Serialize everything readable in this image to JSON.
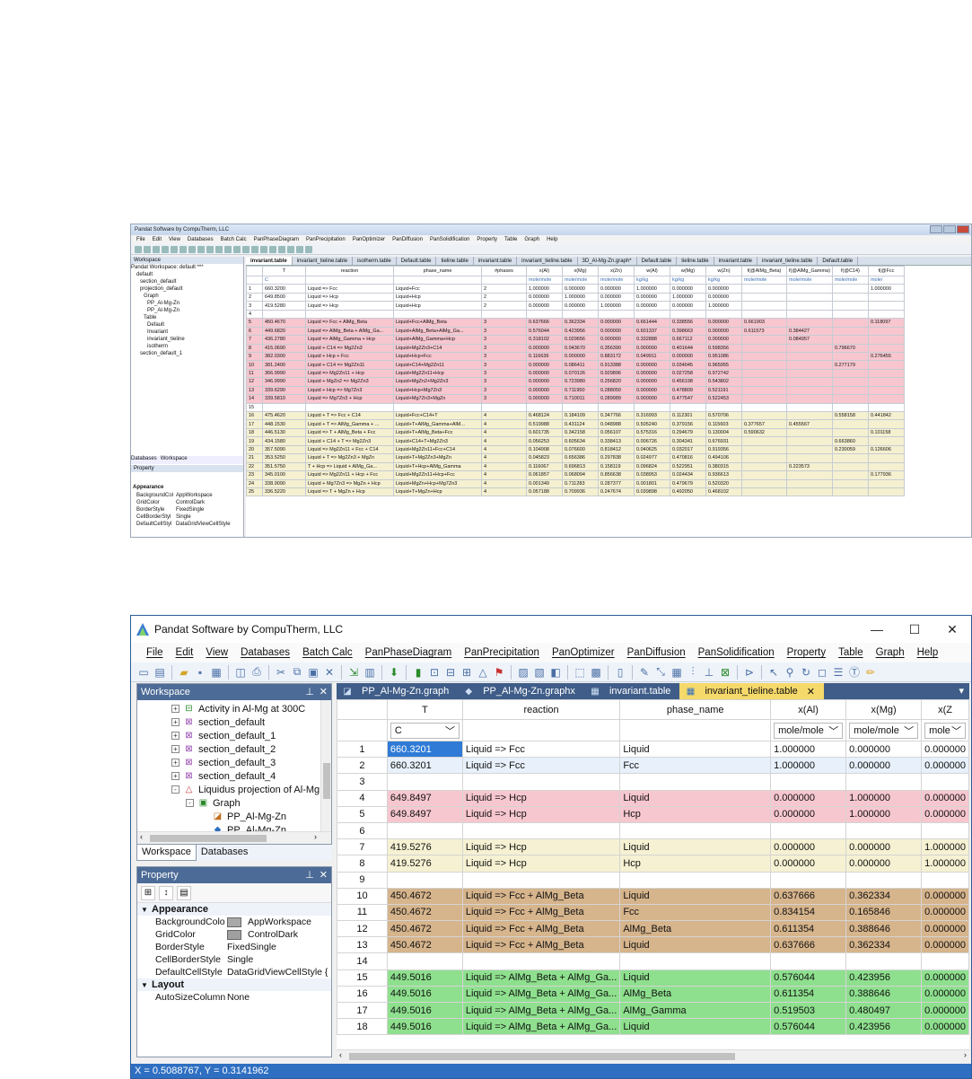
{
  "small_screenshot": {
    "title": "Pandat Software by CompuTherm, LLC",
    "menu": [
      "File",
      "Edit",
      "View",
      "Databases",
      "Batch Calc",
      "PanPhaseDiagram",
      "PanPrecipitation",
      "PanOptimizer",
      "PanDiffusion",
      "PanSolidification",
      "Property",
      "Table",
      "Graph",
      "Help"
    ],
    "workspace_header": "Workspace",
    "tree": [
      "Pandat Workspace: default ***",
      "default",
      "section_default",
      "projection_default",
      "Graph",
      "PP_Al-Mg-Zn",
      "PP_Al-Mg-Zn",
      "Table",
      "Default",
      "Invariant",
      "invariant_tieline",
      "isotherm",
      "section_default_1"
    ],
    "tabs": [
      "invariant.table",
      "invariant_tieline.table",
      "isotherm.table",
      "Default.table",
      "tieline.table",
      "invariant.table",
      "invariant_tieline.table",
      "3D_Al-Mg-Zn.graph*",
      "Default.table",
      "tieline.table",
      "invariant.table",
      "invariant_tieline.table",
      "Default.table"
    ],
    "columns": [
      "",
      "T",
      "reaction",
      "phase_name",
      "#phases",
      "x(Al)",
      "x(Mg)",
      "x(Zn)",
      "w(Al)",
      "w(Mg)",
      "w(Zn)",
      "f(@AlMg_Beta)",
      "f(@AlMg_Gamma)",
      "f(@C14)",
      "f(@Fcc"
    ],
    "units": [
      "",
      "C",
      "",
      "",
      "",
      "mole/mole",
      "mole/mole",
      "mole/mole",
      "kg/kg",
      "kg/kg",
      "kg/kg",
      "mole/mole",
      "mole/mole",
      "mole/mole",
      "mole/"
    ],
    "rows": [
      {
        "c": "wt",
        "v": [
          "1",
          "660.3200",
          "Liquid => Fcc",
          "Liquid+Fcc",
          "2",
          "1.000000",
          "0.000000",
          "0.000000",
          "1.000000",
          "0.000000",
          "0.000000",
          "",
          "",
          "",
          "1.000000"
        ]
      },
      {
        "c": "wt",
        "v": [
          "2",
          "649.8500",
          "Liquid => Hcp",
          "Liquid+Hcp",
          "2",
          "0.000000",
          "1.000000",
          "0.000000",
          "0.000000",
          "1.000000",
          "0.000000",
          "",
          "",
          "",
          ""
        ]
      },
      {
        "c": "wt",
        "v": [
          "3",
          "419.5280",
          "Liquid => Hcp",
          "Liquid+Hcp",
          "2",
          "0.000000",
          "0.000000",
          "1.000000",
          "0.000000",
          "0.000000",
          "1.000000",
          "",
          "",
          "",
          ""
        ]
      },
      {
        "c": "wt",
        "v": [
          "4",
          "",
          "",
          "",
          "",
          "",
          "",
          "",
          "",
          "",
          "",
          "",
          "",
          "",
          ""
        ]
      },
      {
        "c": "pk",
        "v": [
          "5",
          "450.4670",
          "Liquid => Fcc + AlMg_Beta",
          "Liquid+Fcc+AlMg_Beta",
          "3",
          "0.637666",
          "0.362334",
          "0.000000",
          "0.661444",
          "0.338556",
          "0.000000",
          "0.661903",
          "",
          "",
          "0.118097"
        ]
      },
      {
        "c": "pk",
        "v": [
          "6",
          "449.6820",
          "Liquid => AlMg_Beta + AlMg_Ga...",
          "Liquid+AlMg_Beta+AlMg_Ga...",
          "3",
          "0.576044",
          "0.423956",
          "0.000000",
          "0.601337",
          "0.398663",
          "0.000000",
          "0.611573",
          "0.384427",
          "",
          ""
        ]
      },
      {
        "c": "pk",
        "v": [
          "7",
          "436.2780",
          "Liquid => AlMg_Gamma + Hcp",
          "Liquid+AlMg_Gamma+Hcp",
          "3",
          "0.318102",
          "0.029656",
          "0.000000",
          "0.332888",
          "0.667112",
          "0.000000",
          "",
          "0.084957",
          "",
          ""
        ]
      },
      {
        "c": "pk",
        "v": [
          "8",
          "415.0690",
          "Liquid + C14 => Mg2Zn3",
          "Liquid+Mg2Zn3+C14",
          "3",
          "0.000000",
          "0.043670",
          "0.356390",
          "0.000000",
          "0.401644",
          "0.598356",
          "",
          "",
          "0.796670",
          ""
        ]
      },
      {
        "c": "pk",
        "v": [
          "9",
          "382.0300",
          "Liquid + Hcp + Fcc",
          "Liquid+Hcp+Fcc",
          "3",
          "0.116636",
          "0.000000",
          "0.883172",
          "0.049911",
          "0.000000",
          "0.951086",
          "",
          "",
          "",
          "0.276455"
        ]
      },
      {
        "c": "pk",
        "v": [
          "10",
          "381.2400",
          "Liquid + C14 => Mg2Zn11",
          "Liquid+C14+Mg2Zn11",
          "3",
          "0.000000",
          "0.086411",
          "0.913388",
          "0.000000",
          "0.034045",
          "0.965955",
          "",
          "",
          "0.277179",
          ""
        ]
      },
      {
        "c": "pk",
        "v": [
          "11",
          "366.9990",
          "Liquid => Mg2Zn11 + Hcp",
          "Liquid+Mg2Zn11+Hcp",
          "3",
          "0.000000",
          "0.070126",
          "0.929896",
          "0.000000",
          "0.027258",
          "0.972742",
          "",
          "",
          "",
          ""
        ]
      },
      {
        "c": "pk",
        "v": [
          "12",
          "346.9990",
          "Liquid + MgZn2 => Mg2Zn3",
          "Liquid+MgZn2+Mg2Zn3",
          "3",
          "0.000000",
          "0.723980",
          "0.256820",
          "0.000000",
          "0.456198",
          "0.543802",
          "",
          "",
          "",
          ""
        ]
      },
      {
        "c": "pk",
        "v": [
          "13",
          "339.6290",
          "Liquid + Hcp => Mg7Zn3",
          "Liquid+Hcp+Mg7Zn3",
          "3",
          "0.000000",
          "0.711950",
          "0.288050",
          "0.000000",
          "0.478809",
          "0.521191",
          "",
          "",
          "",
          ""
        ]
      },
      {
        "c": "pk",
        "v": [
          "14",
          "339.5810",
          "Liquid => Mg7Zn3 + Hcp",
          "Liquid+Mg7Zn3+MgZn",
          "3",
          "0.000000",
          "0.710011",
          "0.289989",
          "0.000000",
          "0.477547",
          "0.522453",
          "",
          "",
          "",
          ""
        ]
      },
      {
        "c": "wt",
        "v": [
          "15",
          "",
          "",
          "",
          "",
          "",
          "",
          "",
          "",
          "",
          "",
          "",
          "",
          "",
          ""
        ]
      },
      {
        "c": "ye",
        "v": [
          "16",
          "475.4620",
          "Liquid + T => Fcc + C14",
          "Liquid+Fcc+C14+T",
          "4",
          "0.468124",
          "0.184109",
          "0.347766",
          "0.316993",
          "0.112301",
          "0.570706",
          "",
          "",
          "0.558158",
          "0.441842"
        ]
      },
      {
        "c": "ye",
        "v": [
          "17",
          "448.1530",
          "Liquid + T => AlMg_Gamma + ...",
          "Liquid+T+AlMg_Gamma+AlM...",
          "4",
          "0.519988",
          "0.431124",
          "0.048988",
          "0.505240",
          "0.379156",
          "0.115603",
          "0.377657",
          "0.455567",
          "",
          ""
        ]
      },
      {
        "c": "ye",
        "v": [
          "18",
          "446.5130",
          "Liquid => T + AlMg_Beta + Fcc",
          "Liquid+T+AlMg_Beta+Fcc",
          "4",
          "0.601735",
          "0.342158",
          "0.056107",
          "0.575316",
          "0.294679",
          "0.130004",
          "0.590632",
          "",
          "",
          "0.101158"
        ]
      },
      {
        "c": "ye",
        "v": [
          "19",
          "434.1580",
          "Liquid + C14 + T => Mg2Zn3",
          "Liquid+C14+T+Mg2Zn3",
          "4",
          "0.056253",
          "0.605634",
          "0.338413",
          "0.006726",
          "0.304341",
          "0.676931",
          "",
          "",
          "0.663860",
          ""
        ]
      },
      {
        "c": "ye",
        "v": [
          "20",
          "357.5090",
          "Liquid => Mg2Zn11 + Fcc + C14",
          "Liquid+Mg2Zn11+Fcc+C14",
          "4",
          "0.104908",
          "0.076600",
          "0.818412",
          "0.040625",
          "0.032017",
          "0.919356",
          "",
          "",
          "0.230059",
          "0.126606"
        ]
      },
      {
        "c": "ye",
        "v": [
          "21",
          "353.5250",
          "Liquid + T => Mg2Zn3 + MgZn",
          "Liquid+T+Mg2Zn3+MgZn",
          "4",
          "0.045823",
          "0.656386",
          "0.297838",
          "0.024977",
          "0.470816",
          "0.494106",
          "",
          "",
          "",
          ""
        ]
      },
      {
        "c": "ye",
        "v": [
          "22",
          "351.5750",
          "T + Hcp => Liquid + AlMg_Ga...",
          "Liquid+T+Hcp+AlMg_Gamma",
          "4",
          "0.116067",
          "0.696813",
          "0.158119",
          "0.096824",
          "0.522951",
          "0.380315",
          "",
          "0.223573",
          "",
          ""
        ]
      },
      {
        "c": "ye",
        "v": [
          "23",
          "345.0100",
          "Liquid => Mg2Zn11 + Hcp + Fcc",
          "Liquid+Mg2Zn11+Hcp+Fcc",
          "4",
          "0.061857",
          "0.068094",
          "0.856638",
          "0.038953",
          "0.024434",
          "0.936613",
          "",
          "",
          "",
          "0.177936"
        ]
      },
      {
        "c": "ye",
        "v": [
          "24",
          "338.9090",
          "Liquid + Mg7Zn3 => MgZn + Hcp",
          "Liquid+MgZn+Hcp+Mg7Zn3",
          "4",
          "0.001349",
          "0.711283",
          "0.287377",
          "0.001801",
          "0.479679",
          "0.520320",
          "",
          "",
          "",
          ""
        ]
      },
      {
        "c": "ye",
        "v": [
          "25",
          "336.5220",
          "Liquid => T + MgZn + Hcp",
          "Liquid+T+MgZn+Hcp",
          "4",
          "0.057188",
          "0.709936",
          "0.247674",
          "0.039898",
          "0.492050",
          "0.468102",
          "",
          "",
          "",
          ""
        ]
      }
    ],
    "ws_tabs": [
      "Databases",
      "Workspace"
    ],
    "prop_header": "Property",
    "prop_cat": "Appearance",
    "props": [
      [
        "BackgroundCol",
        "AppWorkspace"
      ],
      [
        "GridColor",
        "ControlDark"
      ],
      [
        "BorderStyle",
        "FixedSingle"
      ],
      [
        "CellBorderStyl",
        "Single"
      ],
      [
        "DefaultCellStyl",
        "DataGridViewCellStyle"
      ]
    ]
  },
  "window": {
    "title": "Pandat Software by CompuTherm, LLC",
    "controls": [
      "—",
      "☐",
      "✕"
    ],
    "menu": [
      "File",
      "Edit",
      "View",
      "Databases",
      "Batch Calc",
      "PanPhaseDiagram",
      "PanPrecipitation",
      "PanOptimizer",
      "PanDiffusion",
      "PanSolidification",
      "Property",
      "Table",
      "Graph",
      "Help"
    ]
  },
  "workspace": {
    "header": "Workspace",
    "items": [
      {
        "label": "Activity in Al-Mg at 300C",
        "level": 0,
        "icon": "plot-line-icon",
        "pm": "+"
      },
      {
        "label": "section_default",
        "level": 0,
        "icon": "section-icon",
        "pm": "+"
      },
      {
        "label": "section_default_1",
        "level": 0,
        "icon": "section-icon",
        "pm": "+"
      },
      {
        "label": "section_default_2",
        "level": 0,
        "icon": "section-icon",
        "pm": "+"
      },
      {
        "label": "section_default_3",
        "level": 0,
        "icon": "section-icon",
        "pm": "+"
      },
      {
        "label": "section_default_4",
        "level": 0,
        "icon": "section-icon",
        "pm": "+"
      },
      {
        "label": "Liquidus projection of Al-Mg",
        "level": 0,
        "icon": "projection-icon",
        "pm": "-"
      },
      {
        "label": "Graph",
        "level": 1,
        "icon": "graph-folder-icon",
        "pm": "-"
      },
      {
        "label": "PP_Al-Mg-Zn",
        "level": 2,
        "icon": "graph-icon",
        "pm": ""
      },
      {
        "label": "PP_Al-Mg-Zn",
        "level": 2,
        "icon": "graph3d-icon",
        "pm": ""
      }
    ],
    "tabs": [
      "Workspace",
      "Databases"
    ]
  },
  "property": {
    "header": "Property",
    "categories": [
      {
        "name": "Appearance",
        "rows": [
          {
            "key": "BackgroundColo",
            "value": "AppWorkspace",
            "swatch": "#a9a9a9"
          },
          {
            "key": "GridColor",
            "value": "ControlDark",
            "swatch": "#a0a0a0"
          },
          {
            "key": "BorderStyle",
            "value": "FixedSingle",
            "swatch": ""
          },
          {
            "key": "CellBorderStyle",
            "value": "Single",
            "swatch": ""
          },
          {
            "key": "DefaultCellStyle",
            "value": "DataGridViewCellStyle {",
            "swatch": ""
          }
        ]
      },
      {
        "name": "Layout",
        "rows": [
          {
            "key": "AutoSizeColumn",
            "value": "None",
            "swatch": ""
          }
        ]
      }
    ]
  },
  "doc_tabs": [
    {
      "label": "PP_Al-Mg-Zn.graph",
      "icon": "graph-icon",
      "active": false
    },
    {
      "label": "PP_Al-Mg-Zn.graphx",
      "icon": "graph3d-icon",
      "active": false
    },
    {
      "label": "invariant.table",
      "icon": "table-icon",
      "active": false
    },
    {
      "label": "invariant_tieline.table",
      "icon": "table-icon",
      "active": true
    }
  ],
  "grid": {
    "headers": [
      "",
      "T",
      "reaction",
      "phase_name",
      "x(Al)",
      "x(Mg)",
      "x(Z"
    ],
    "units": [
      "",
      "C",
      "",
      "",
      "mole/mole",
      "mole/mole",
      "mole"
    ],
    "rows": [
      {
        "n": "1",
        "c": "w",
        "T": "660.3201",
        "reaction": "Liquid => Fcc",
        "phase": "Liquid",
        "xal": "1.000000",
        "xmg": "0.000000",
        "xzn": "0.000000",
        "cur": true
      },
      {
        "n": "2",
        "c": "b",
        "T": "660.3201",
        "reaction": "Liquid => Fcc",
        "phase": "Fcc",
        "xal": "1.000000",
        "xmg": "0.000000",
        "xzn": "0.000000"
      },
      {
        "n": "3",
        "c": "w",
        "T": "",
        "reaction": "",
        "phase": "",
        "xal": "",
        "xmg": "",
        "xzn": ""
      },
      {
        "n": "4",
        "c": "pk",
        "T": "649.8497",
        "reaction": "Liquid => Hcp",
        "phase": "Liquid",
        "xal": "0.000000",
        "xmg": "1.000000",
        "xzn": "0.000000"
      },
      {
        "n": "5",
        "c": "pk",
        "T": "649.8497",
        "reaction": "Liquid => Hcp",
        "phase": "Hcp",
        "xal": "0.000000",
        "xmg": "1.000000",
        "xzn": "0.000000"
      },
      {
        "n": "6",
        "c": "w",
        "T": "",
        "reaction": "",
        "phase": "",
        "xal": "",
        "xmg": "",
        "xzn": ""
      },
      {
        "n": "7",
        "c": "ye",
        "T": "419.5276",
        "reaction": "Liquid => Hcp",
        "phase": "Liquid",
        "xal": "0.000000",
        "xmg": "0.000000",
        "xzn": "1.000000"
      },
      {
        "n": "8",
        "c": "ye",
        "T": "419.5276",
        "reaction": "Liquid => Hcp",
        "phase": "Hcp",
        "xal": "0.000000",
        "xmg": "0.000000",
        "xzn": "1.000000"
      },
      {
        "n": "9",
        "c": "w",
        "T": "",
        "reaction": "",
        "phase": "",
        "xal": "",
        "xmg": "",
        "xzn": ""
      },
      {
        "n": "10",
        "c": "br",
        "T": "450.4672",
        "reaction": "Liquid => Fcc + AlMg_Beta",
        "phase": "Liquid",
        "xal": "0.637666",
        "xmg": "0.362334",
        "xzn": "0.000000"
      },
      {
        "n": "11",
        "c": "br",
        "T": "450.4672",
        "reaction": "Liquid => Fcc + AlMg_Beta",
        "phase": "Fcc",
        "xal": "0.834154",
        "xmg": "0.165846",
        "xzn": "0.000000"
      },
      {
        "n": "12",
        "c": "br",
        "T": "450.4672",
        "reaction": "Liquid => Fcc + AlMg_Beta",
        "phase": "AlMg_Beta",
        "xal": "0.611354",
        "xmg": "0.388646",
        "xzn": "0.000000"
      },
      {
        "n": "13",
        "c": "br",
        "T": "450.4672",
        "reaction": "Liquid => Fcc + AlMg_Beta",
        "phase": "Liquid",
        "xal": "0.637666",
        "xmg": "0.362334",
        "xzn": "0.000000"
      },
      {
        "n": "14",
        "c": "w",
        "T": "",
        "reaction": "",
        "phase": "",
        "xal": "",
        "xmg": "",
        "xzn": ""
      },
      {
        "n": "15",
        "c": "gr",
        "T": "449.5016",
        "reaction": "Liquid => AlMg_Beta + AlMg_Ga...",
        "phase": "Liquid",
        "xal": "0.576044",
        "xmg": "0.423956",
        "xzn": "0.000000"
      },
      {
        "n": "16",
        "c": "gr",
        "T": "449.5016",
        "reaction": "Liquid => AlMg_Beta + AlMg_Ga...",
        "phase": "AlMg_Beta",
        "xal": "0.611354",
        "xmg": "0.388646",
        "xzn": "0.000000"
      },
      {
        "n": "17",
        "c": "gr",
        "T": "449.5016",
        "reaction": "Liquid => AlMg_Beta + AlMg_Ga...",
        "phase": "AlMg_Gamma",
        "xal": "0.519503",
        "xmg": "0.480497",
        "xzn": "0.000000"
      },
      {
        "n": "18",
        "c": "gr",
        "T": "449.5016",
        "reaction": "Liquid => AlMg_Beta + AlMg_Ga...",
        "phase": "Liquid",
        "xal": "0.576044",
        "xmg": "0.423956",
        "xzn": "0.000000"
      }
    ]
  },
  "status": {
    "text": "X = 0.5088767, Y = 0.3141962"
  },
  "colors": {
    "accent": "#2f6fc2",
    "pane_header": "#4c6b96",
    "tab_active": "#f5d96b",
    "row_pink": "#f7c7cf",
    "row_yellow": "#f6f1d2",
    "row_brown": "#d6b48c",
    "row_green": "#8ee08e"
  }
}
